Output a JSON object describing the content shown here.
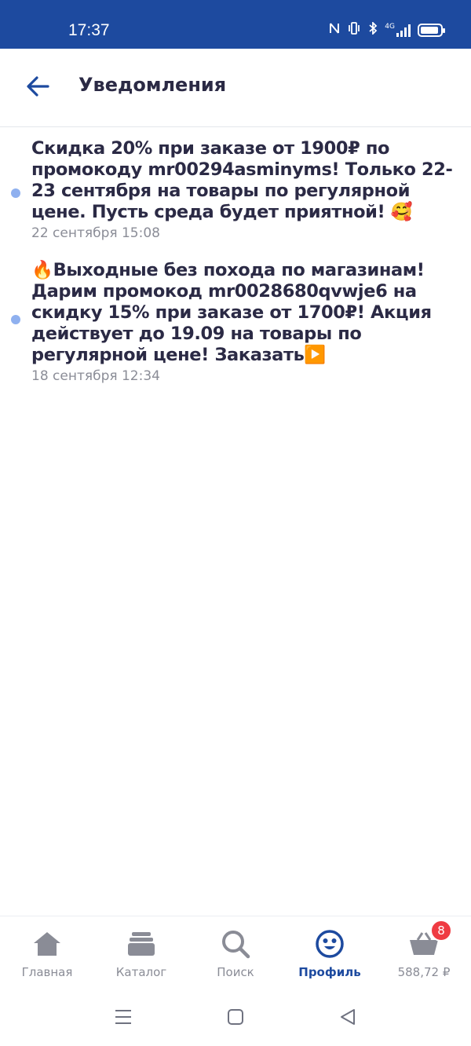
{
  "status_bar": {
    "time": "17:37",
    "network": "4G",
    "colors": {
      "background": "#1d4a9f"
    }
  },
  "header": {
    "title": "Уведомления",
    "back_icon": "arrow-left-icon"
  },
  "notifications": [
    {
      "text": "Скидка 20% при заказе от 1900₽ по промокоду mr00294asminyms! Только 22-23 сентября на товары по регулярной цене. Пусть среда будет приятной! 🥰",
      "time": "22 сентября 15:08",
      "unread": true
    },
    {
      "text": "🔥Выходные без похода по магазинам! Дарим промокод mr0028680qvwje6 на скидку 15% при заказе от 1700₽! Акция действует до 19.09 на товары по регулярной цене! Заказать▶️",
      "time": "18 сентября 12:34",
      "unread": true
    }
  ],
  "tab_bar": {
    "items": [
      {
        "label": "Главная",
        "icon": "home-icon"
      },
      {
        "label": "Каталог",
        "icon": "catalog-icon"
      },
      {
        "label": "Поиск",
        "icon": "search-icon"
      },
      {
        "label": "Профиль",
        "icon": "profile-smiley-icon",
        "active": true
      },
      {
        "label": "588,72 ₽",
        "icon": "basket-icon",
        "badge": "8"
      }
    ]
  },
  "colors": {
    "accent": "#1d4a9f",
    "unread_dot": "#8fb0ef",
    "badge": "#ef3b42",
    "text": "#2b2a45",
    "muted": "#8b8d97"
  }
}
